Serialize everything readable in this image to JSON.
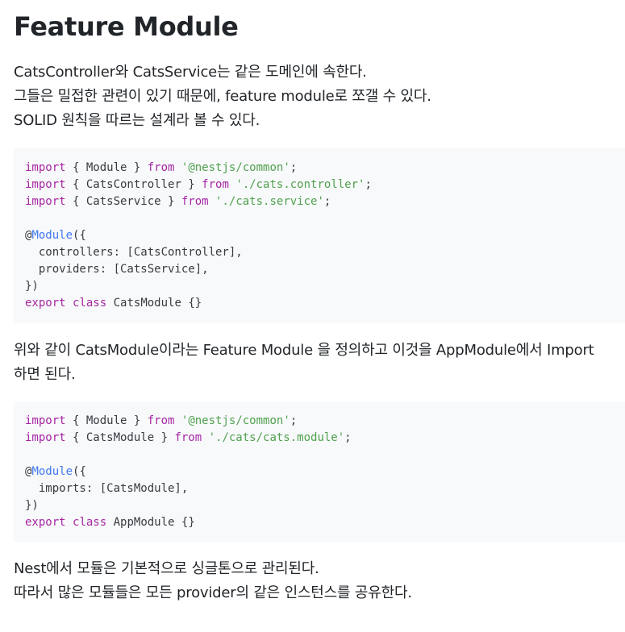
{
  "title": "Feature Module",
  "para1": [
    "CatsController와 CatsService는 같은 도메인에 속한다.",
    "그들은 밀접한 관련이 있기 때문에, feature module로 쪼갤 수 있다.",
    "SOLID 원칙을 따르는 설계라 볼 수 있다."
  ],
  "code1": [
    [
      {
        "t": "import",
        "c": "kw"
      },
      {
        "t": " { Module } ",
        "c": "pl"
      },
      {
        "t": "from",
        "c": "kw"
      },
      {
        "t": " ",
        "c": "pl"
      },
      {
        "t": "'@nestjs/common'",
        "c": "str"
      },
      {
        "t": ";",
        "c": "pl"
      }
    ],
    [
      {
        "t": "import",
        "c": "kw"
      },
      {
        "t": " { CatsController } ",
        "c": "pl"
      },
      {
        "t": "from",
        "c": "kw"
      },
      {
        "t": " ",
        "c": "pl"
      },
      {
        "t": "'./cats.controller'",
        "c": "str"
      },
      {
        "t": ";",
        "c": "pl"
      }
    ],
    [
      {
        "t": "import",
        "c": "kw"
      },
      {
        "t": " { CatsService } ",
        "c": "pl"
      },
      {
        "t": "from",
        "c": "kw"
      },
      {
        "t": " ",
        "c": "pl"
      },
      {
        "t": "'./cats.service'",
        "c": "str"
      },
      {
        "t": ";",
        "c": "pl"
      }
    ],
    [],
    [
      {
        "t": "@",
        "c": "pl"
      },
      {
        "t": "Module",
        "c": "dec"
      },
      {
        "t": "({",
        "c": "pl"
      }
    ],
    [
      {
        "t": "  controllers: [CatsController],",
        "c": "pl"
      }
    ],
    [
      {
        "t": "  providers: [CatsService],",
        "c": "pl"
      }
    ],
    [
      {
        "t": "})",
        "c": "pl"
      }
    ],
    [
      {
        "t": "export",
        "c": "kw"
      },
      {
        "t": " ",
        "c": "pl"
      },
      {
        "t": "class",
        "c": "kw"
      },
      {
        "t": " CatsModule {}",
        "c": "pl"
      }
    ]
  ],
  "para2": [
    "위와 같이 CatsModule이라는 Feature Module 을 정의하고 이것을 AppModule에서 Import",
    "하면 된다."
  ],
  "code2": [
    [
      {
        "t": "import",
        "c": "kw"
      },
      {
        "t": " { Module } ",
        "c": "pl"
      },
      {
        "t": "from",
        "c": "kw"
      },
      {
        "t": " ",
        "c": "pl"
      },
      {
        "t": "'@nestjs/common'",
        "c": "str"
      },
      {
        "t": ";",
        "c": "pl"
      }
    ],
    [
      {
        "t": "import",
        "c": "kw"
      },
      {
        "t": " { CatsModule } ",
        "c": "pl"
      },
      {
        "t": "from",
        "c": "kw"
      },
      {
        "t": " ",
        "c": "pl"
      },
      {
        "t": "'./cats/cats.module'",
        "c": "str"
      },
      {
        "t": ";",
        "c": "pl"
      }
    ],
    [],
    [
      {
        "t": "@",
        "c": "pl"
      },
      {
        "t": "Module",
        "c": "dec"
      },
      {
        "t": "({",
        "c": "pl"
      }
    ],
    [
      {
        "t": "  imports: [CatsModule],",
        "c": "pl"
      }
    ],
    [
      {
        "t": "})",
        "c": "pl"
      }
    ],
    [
      {
        "t": "export",
        "c": "kw"
      },
      {
        "t": " ",
        "c": "pl"
      },
      {
        "t": "class",
        "c": "kw"
      },
      {
        "t": " AppModule {}",
        "c": "pl"
      }
    ]
  ],
  "para3": [
    "Nest에서 모듈은 기본적으로 싱글톤으로 관리된다.",
    "따라서 많은 모듈들은 모든 provider의 같은 인스턴스를 공유한다."
  ],
  "colors": {
    "keyword": "#a626a4",
    "string": "#50a14f",
    "decorator": "#4078f2",
    "code_background": "#f8f9fa"
  }
}
